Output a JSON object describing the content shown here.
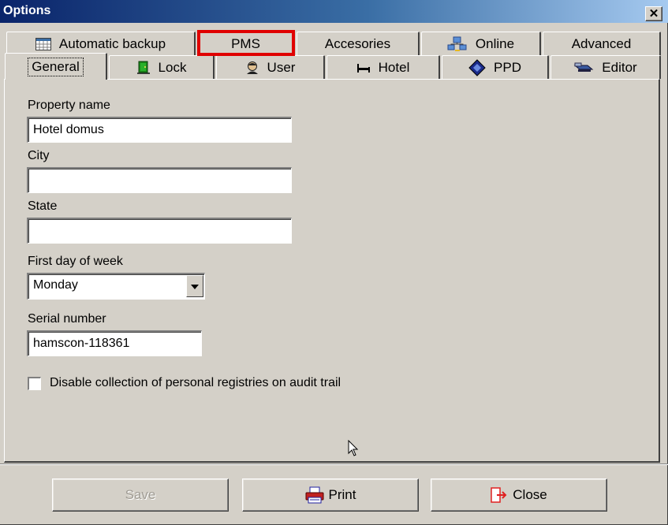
{
  "window": {
    "title": "Options"
  },
  "tabs": {
    "row1": [
      {
        "label": "Automatic backup",
        "icon": "calendar-grid-icon"
      },
      {
        "label": "PMS",
        "icon": ""
      },
      {
        "label": "Accesories",
        "icon": ""
      },
      {
        "label": "Online",
        "icon": "network-computers-icon"
      },
      {
        "label": "Advanced",
        "icon": ""
      }
    ],
    "row2": [
      {
        "label": "General",
        "icon": "",
        "selected": true
      },
      {
        "label": "Lock",
        "icon": "green-door-icon"
      },
      {
        "label": "User",
        "icon": "user-head-icon"
      },
      {
        "label": "Hotel",
        "icon": "bed-icon"
      },
      {
        "label": "PPD",
        "icon": "diamond-card-icon"
      },
      {
        "label": "Editor",
        "icon": "card-reader-icon"
      }
    ],
    "highlighted": "PMS",
    "highlight_color": "#e00000"
  },
  "form": {
    "property_name": {
      "label": "Property name",
      "value": "Hotel domus"
    },
    "city": {
      "label": "City",
      "value": ""
    },
    "state": {
      "label": "State",
      "value": ""
    },
    "first_day": {
      "label": "First day of week",
      "value": "Monday"
    },
    "serial": {
      "label": "Serial number",
      "value": "hamscon-118361"
    },
    "disable_collection": {
      "label": "Disable collection of personal registries on audit trail",
      "checked": false
    }
  },
  "buttons": {
    "save": {
      "label": "Save",
      "enabled": false
    },
    "print": {
      "label": "Print",
      "icon": "printer-icon"
    },
    "close": {
      "label": "Close",
      "icon": "exit-door-icon"
    }
  }
}
